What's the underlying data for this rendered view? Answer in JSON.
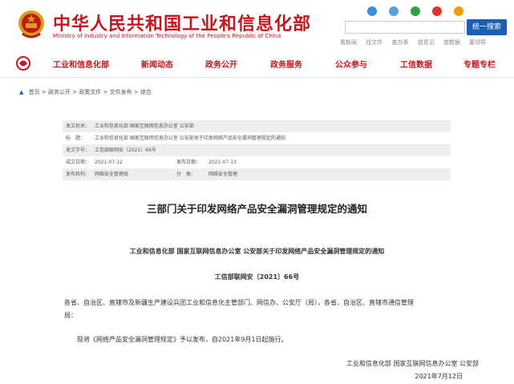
{
  "header": {
    "title": "中华人民共和国工业和信息化部",
    "subtitle": "Ministry of Industry and Information Technology of the People's Republic of China",
    "search_button": "统一搜索",
    "quick_links": [
      "看新闻",
      "找文件",
      "查办事",
      "提意见",
      "查数据",
      "要领导"
    ]
  },
  "nav": {
    "items": [
      "工业和信息化部",
      "新闻动态",
      "政务公开",
      "政务服务",
      "公众参与",
      "工信数据",
      "专题专栏"
    ]
  },
  "breadcrumb": [
    "首页",
    "政务公开",
    "政策文件",
    "文件发布",
    "综合"
  ],
  "meta": {
    "issuer_label": "发文机关：",
    "issuer": "工业和信息化部 国家互联网信息办公室 公安部",
    "title_label": "标　题：",
    "title": "工业和信息化部 国家互联网信息办公室 公安部关于印发网络产品安全漏洞管理规定的通知",
    "docno_label": "发文字号：",
    "docno": "工信部联网安〔2021〕66号",
    "date_label": "成文日期：",
    "date": "2021-07-12",
    "pub_label": "发布日期：",
    "pub_date": "2021-07-13",
    "org_label": "发布机构：",
    "org": "网络安全管理局",
    "cat_label": "分　类：",
    "category": "网络安全管理"
  },
  "document": {
    "title": "三部门关于印发网络产品安全漏洞管理规定的通知",
    "subheading": "工业和信息化部 国家互联网信息办公室 公安部关于印发网络产品安全漏洞管理规定的通知",
    "docno": "工信部联网安〔2021〕66号",
    "addressee_line1": "各省、自治区、直辖市及新疆生产建设兵团工业和信息化主管部门、网信办、公安厅（局），各省、自治区、直辖市通信管理",
    "addressee_line2": "局：",
    "body": "现将《网络产品安全漏洞管理规定》予以发布，自2021年9月1日起施行。",
    "signature": "工业和信息化部 国家互联网信息办公室 公安部",
    "sign_date": "2021年7月12日"
  },
  "colors": {
    "brand_red": "#c4161c",
    "link_blue": "#1a5fb4"
  }
}
